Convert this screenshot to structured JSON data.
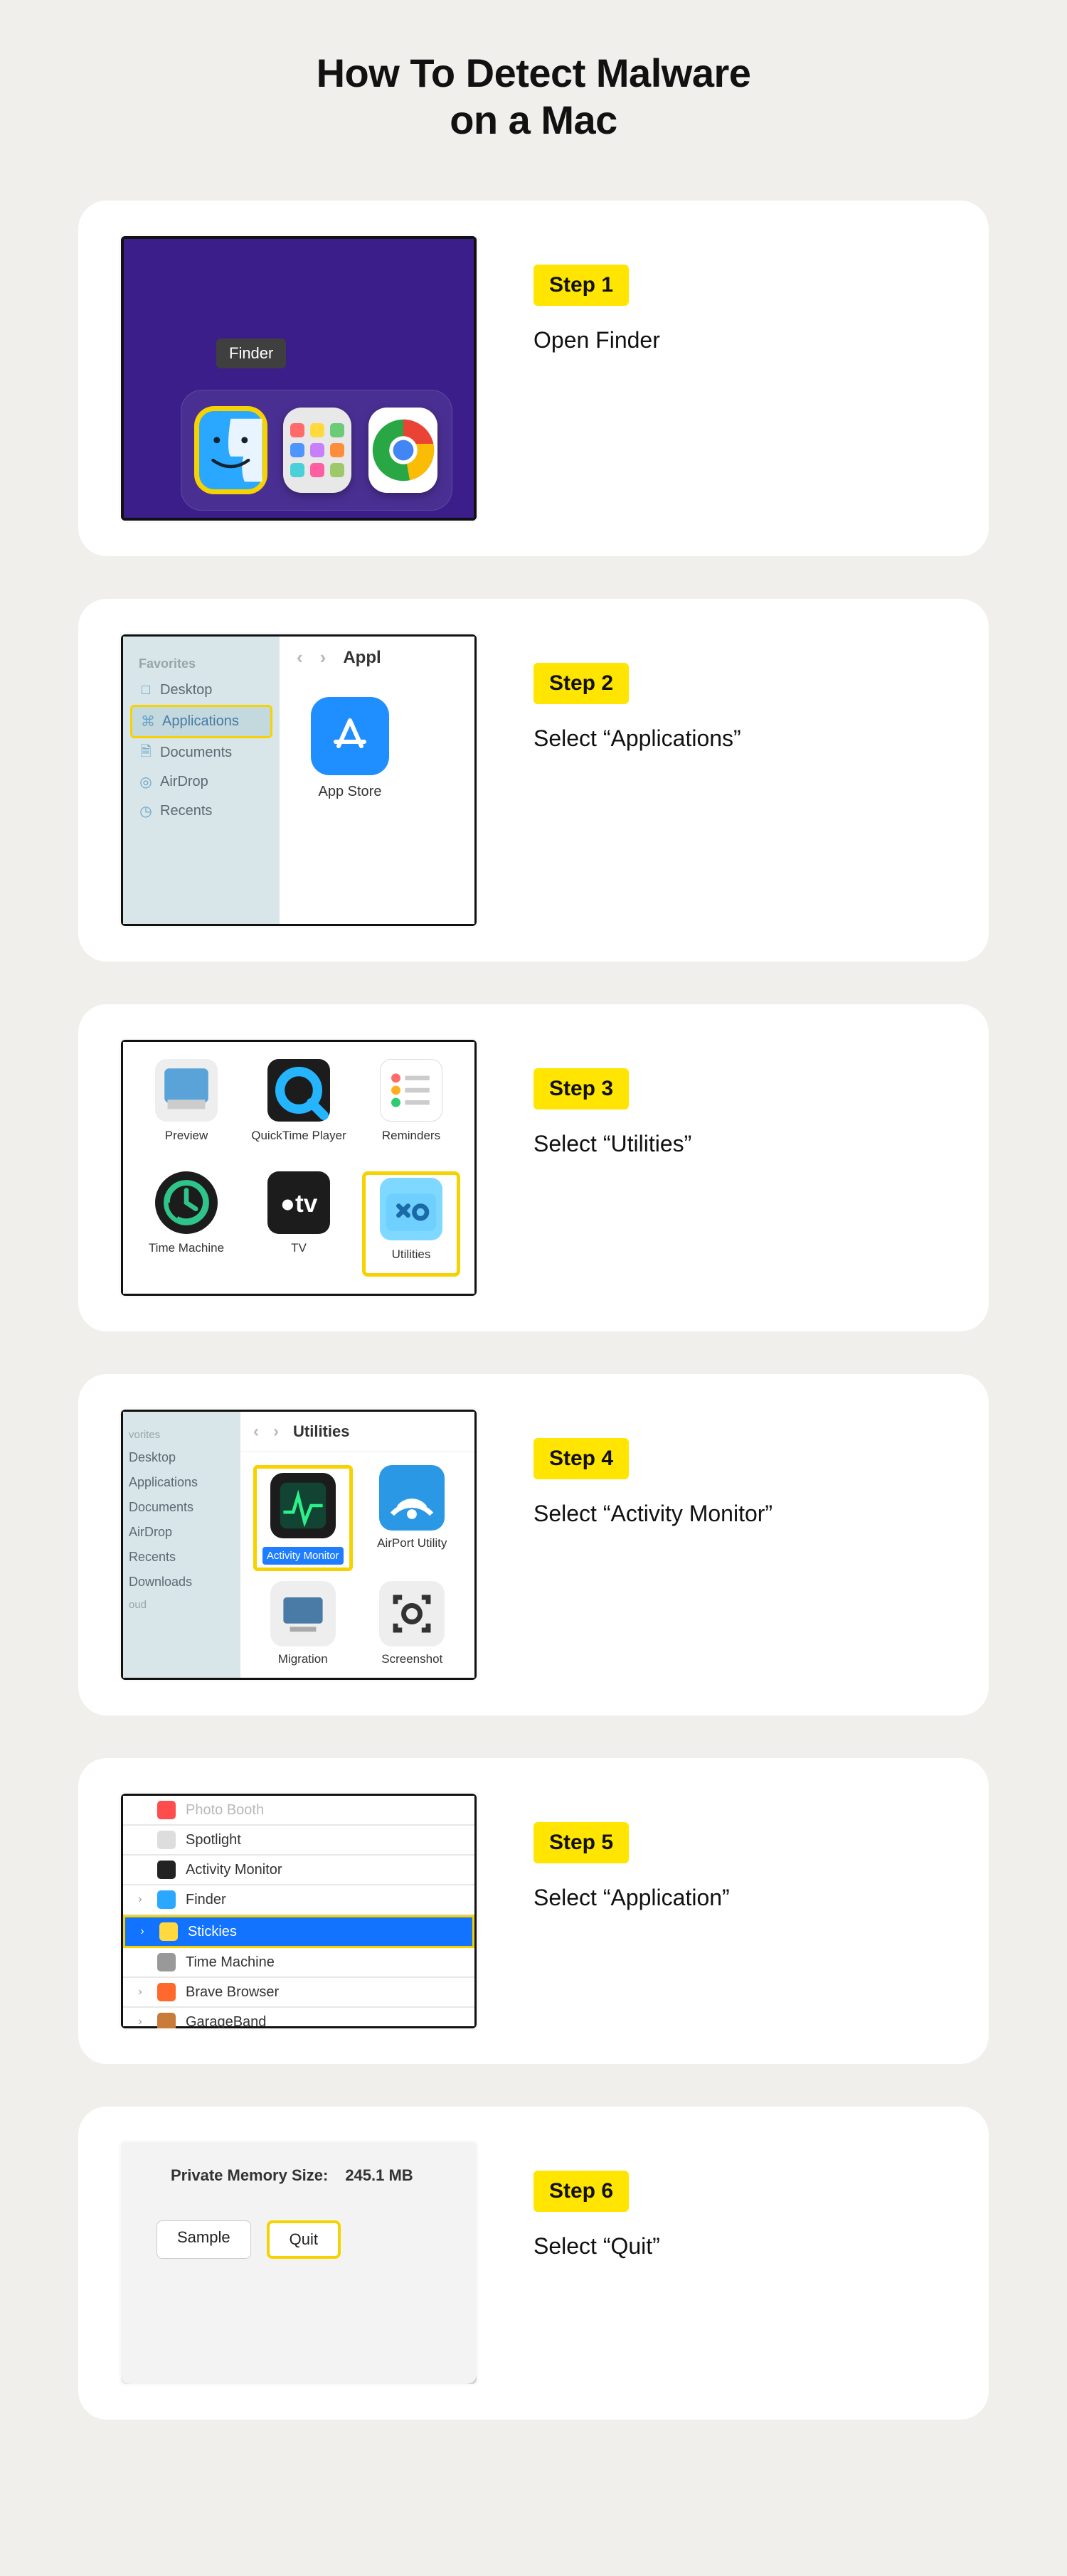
{
  "title_line1": "How To Detect Malware",
  "title_line2": "on a Mac",
  "steps": [
    {
      "badge": "Step 1",
      "desc": "Open Finder"
    },
    {
      "badge": "Step 2",
      "desc": "Select “Applications”"
    },
    {
      "badge": "Step 3",
      "desc": "Select “Utilities”"
    },
    {
      "badge": "Step 4",
      "desc": "Select “Activity Monitor”"
    },
    {
      "badge": "Step 5",
      "desc": "Select “Application”"
    },
    {
      "badge": "Step 6",
      "desc": "Select “Quit”"
    }
  ],
  "s1": {
    "tooltip": "Finder",
    "launch_colors": [
      "#ff6b6b",
      "#ffd93d",
      "#6bcB77",
      "#4d96ff",
      "#c780fa",
      "#ff8e3c",
      "#4ad0d9",
      "#ff5fa2",
      "#9dc96b"
    ]
  },
  "s2": {
    "favorites": "Favorites",
    "items": [
      {
        "label": "Desktop",
        "icon": "desktop-icon"
      },
      {
        "label": "Applications",
        "icon": "applications-icon",
        "hl": true
      },
      {
        "label": "Documents",
        "icon": "documents-icon"
      },
      {
        "label": "AirDrop",
        "icon": "airdrop-icon"
      },
      {
        "label": "Recents",
        "icon": "recents-icon"
      }
    ],
    "nav_back": "‹",
    "nav_fwd": "›",
    "crumb": "Appl",
    "app_label": "App Store"
  },
  "s3": {
    "items": [
      {
        "label": "Preview",
        "name": "preview-app-icon"
      },
      {
        "label": "QuickTime Player",
        "name": "quicktime-app-icon"
      },
      {
        "label": "Reminders",
        "name": "reminders-app-icon"
      },
      {
        "label": "Time Machine",
        "name": "timemachine-app-icon"
      },
      {
        "label": "TV",
        "name": "tv-app-icon"
      },
      {
        "label": "Utilities",
        "name": "utilities-folder-icon",
        "hl": true,
        "pill": "Utilities"
      }
    ]
  },
  "s4": {
    "side_hdr1": "vorites",
    "rows1": [
      "Desktop",
      "Applications",
      "Documents",
      "AirDrop",
      "Recents",
      "Downloads"
    ],
    "side_hdr2": "oud",
    "crumb": "Utilities",
    "nav_back": "‹",
    "nav_fwd": "›",
    "items": [
      {
        "label": "Activity Monitor",
        "hl": true,
        "name": "activity-monitor-icon"
      },
      {
        "label": "AirPort Utility",
        "name": "airport-utility-icon"
      },
      {
        "label": "Migration",
        "name": "migration-icon"
      },
      {
        "label": "Screenshot",
        "name": "screenshot-icon"
      }
    ]
  },
  "s5": {
    "rows": [
      {
        "label": "Photo Booth",
        "dim": true,
        "chev": "",
        "color": "#ff4d4d"
      },
      {
        "label": "Spotlight",
        "dim": false,
        "chev": "",
        "color": "#ddd"
      },
      {
        "label": "Activity Monitor",
        "dim": false,
        "chev": "",
        "color": "#222"
      },
      {
        "label": "Finder",
        "dim": false,
        "chev": "›",
        "color": "#2aa7ff"
      },
      {
        "label": "Stickies",
        "dim": false,
        "chev": "›",
        "sel": true,
        "color": "#ffd93d"
      },
      {
        "label": "Time Machine",
        "dim": false,
        "chev": "",
        "color": "#999"
      },
      {
        "label": "Brave Browser",
        "dim": false,
        "chev": "›",
        "color": "#ff6a2c"
      },
      {
        "label": "GarageBand",
        "dim": false,
        "chev": "›",
        "color": "#c97b3a"
      }
    ]
  },
  "s6": {
    "meta_label": "Private Memory Size:",
    "meta_value": "245.1 MB",
    "btn_sample": "Sample",
    "btn_quit": "Quit"
  }
}
